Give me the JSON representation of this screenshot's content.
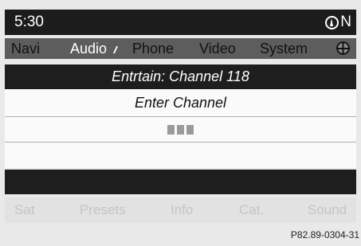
{
  "status": {
    "time": "5:30",
    "compass_icon": "compass-icon",
    "heading": "N"
  },
  "main_menu": {
    "items": [
      {
        "label": "Navi",
        "active": false
      },
      {
        "label": "Audio",
        "active": true
      },
      {
        "label": "Phone",
        "active": false
      },
      {
        "label": "Video",
        "active": false
      },
      {
        "label": "System",
        "active": false
      }
    ],
    "globe_icon": "globe-icon"
  },
  "title": "Entrtain: Channel 118",
  "content": {
    "prompt": "Enter Channel",
    "entry_placeholder_count": 3
  },
  "sub_menu": {
    "items": [
      "Sat",
      "Presets",
      "Info",
      "Cat.",
      "Sound"
    ]
  },
  "reference": "P82.89-0304-31",
  "colors": {
    "active_text": "#ffffff",
    "menu_background": "#5d5d5d",
    "dark_bar": "#1e1e1e",
    "disabled_text": "#c4c4c4"
  }
}
